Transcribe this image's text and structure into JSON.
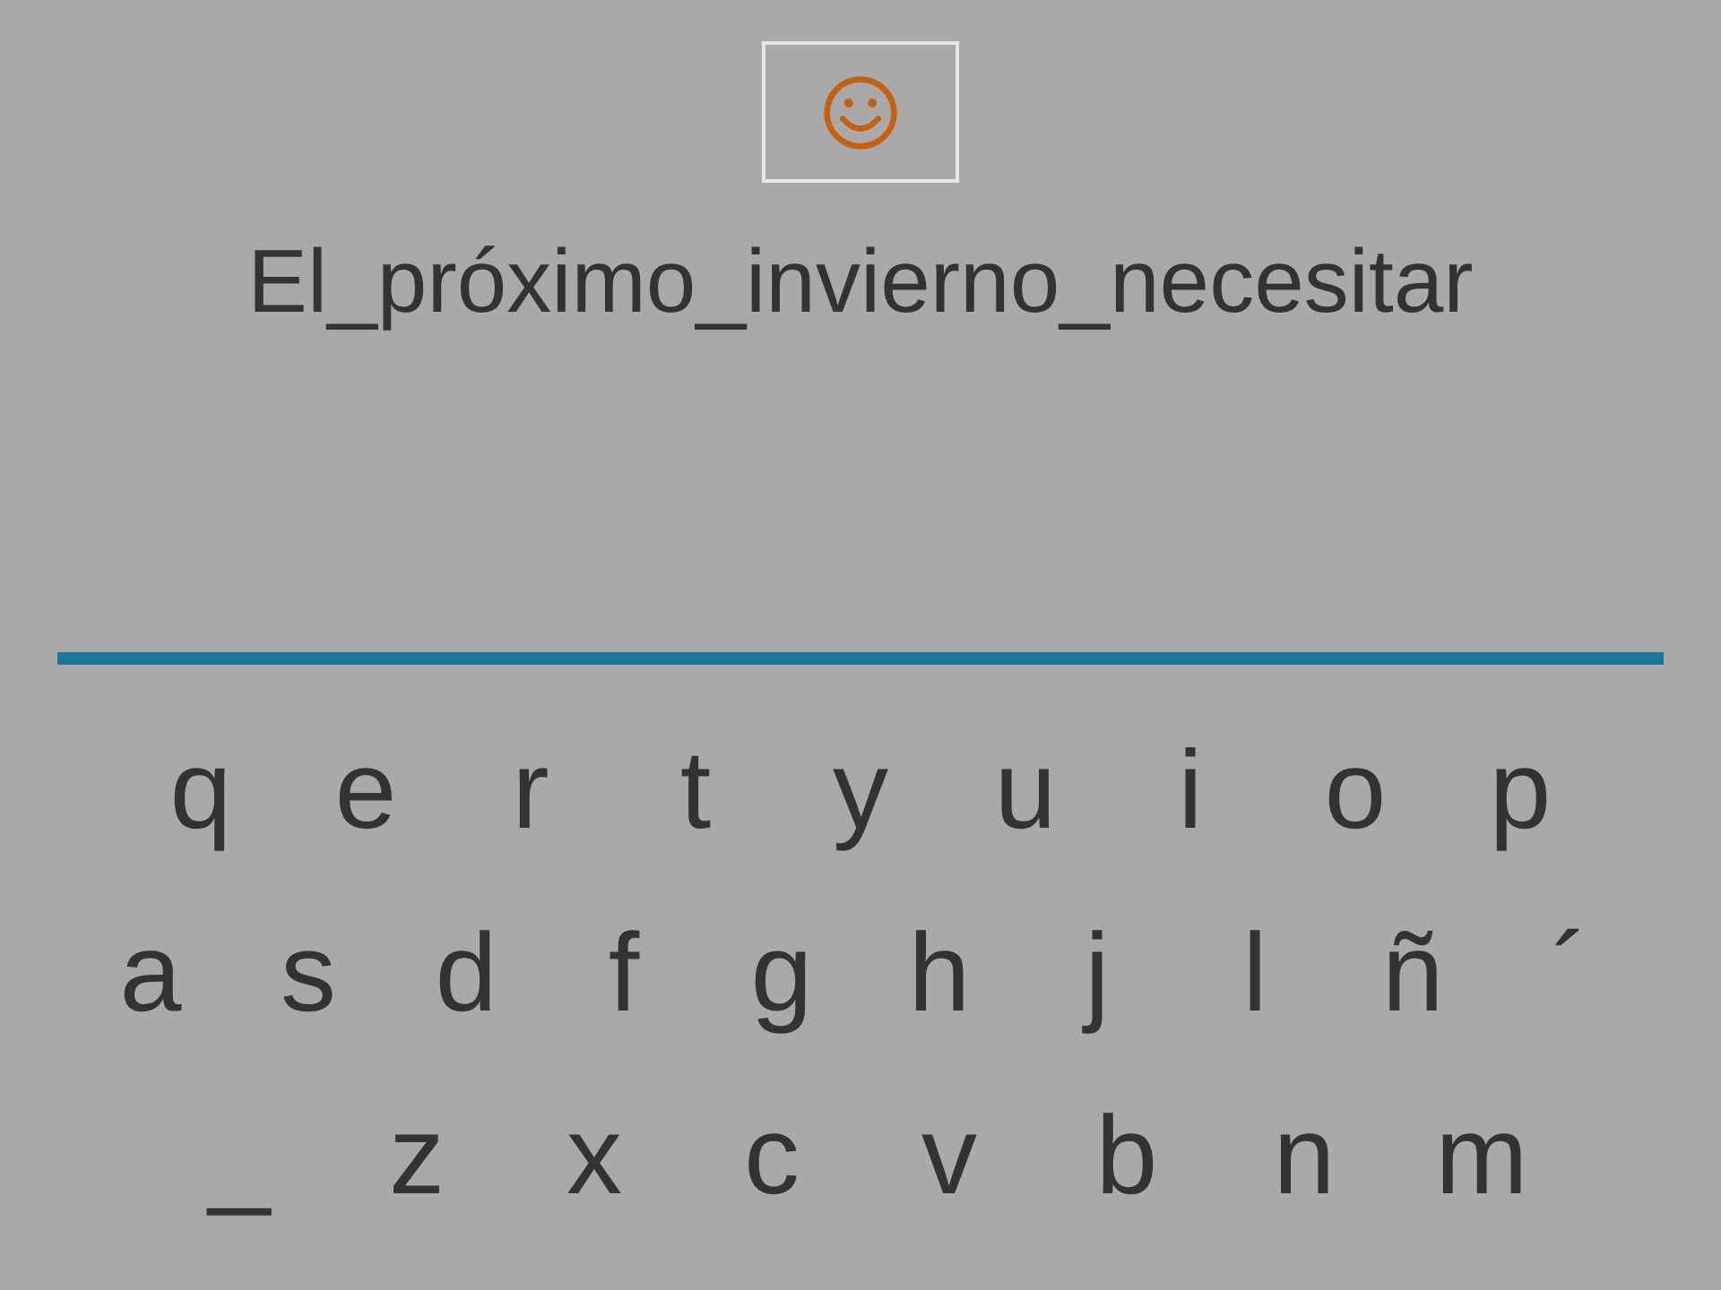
{
  "prompt": "El_próximo_invierno_necesitar",
  "keyboard": {
    "rows": [
      [
        "q",
        "e",
        "r",
        "t",
        "y",
        "u",
        "i",
        "o",
        "p"
      ],
      [
        "a",
        "s",
        "d",
        "f",
        "g",
        "h",
        "j",
        "l",
        "ñ",
        "´"
      ],
      [
        "_",
        "z",
        "x",
        "c",
        "v",
        "b",
        "n",
        "m"
      ]
    ]
  }
}
